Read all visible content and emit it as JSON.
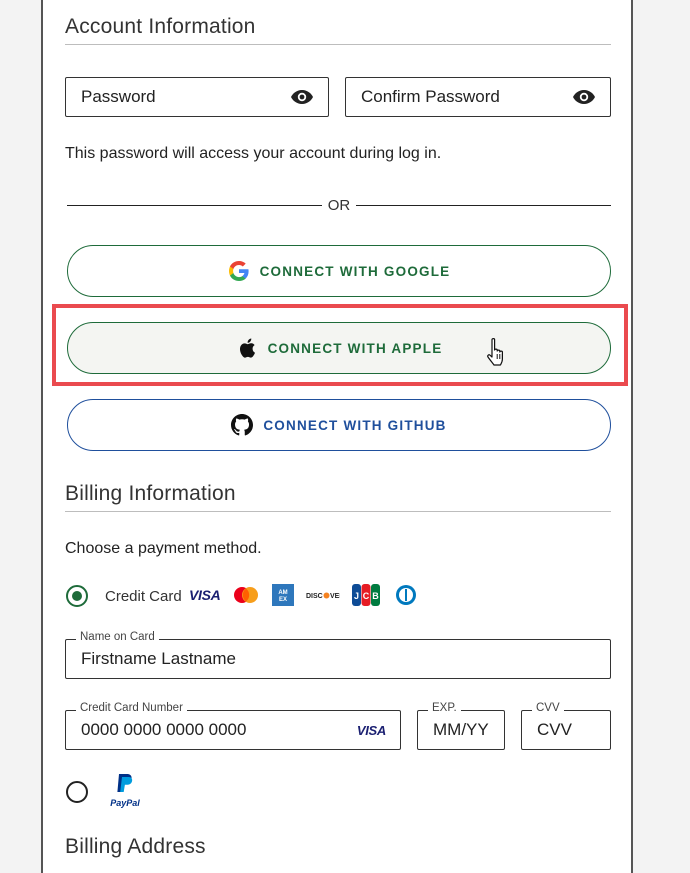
{
  "account": {
    "title": "Account Information",
    "password_placeholder": "Password",
    "confirm_placeholder": "Confirm Password",
    "help_text": "This password will access your account during log in.",
    "or_text": "OR"
  },
  "social": {
    "google": "CONNECT WITH GOOGLE",
    "apple": "CONNECT WITH APPLE",
    "github": "CONNECT WITH GITHUB"
  },
  "billing": {
    "title": "Billing Information",
    "choose_text": "Choose a payment method.",
    "credit_card_label": "Credit Card",
    "card_brands": [
      "VISA",
      "Mastercard",
      "AMEX",
      "DISCOVER",
      "JCB",
      "Diners Club"
    ],
    "name_on_card_label": "Name on Card",
    "name_on_card_value": "Firstname Lastname",
    "card_number_label": "Credit Card Number",
    "card_number_value": "0000 0000 0000 0000",
    "card_number_brand": "VISA",
    "exp_label": "EXP.",
    "exp_value": "MM/YY",
    "cvv_label": "CVV",
    "cvv_value": "CVV",
    "paypal_label": "PayPal"
  },
  "address": {
    "title": "Billing Address"
  },
  "colors": {
    "green": "#1e6b3a",
    "blue": "#1f4f9c",
    "highlight": "#ea4a4f"
  }
}
